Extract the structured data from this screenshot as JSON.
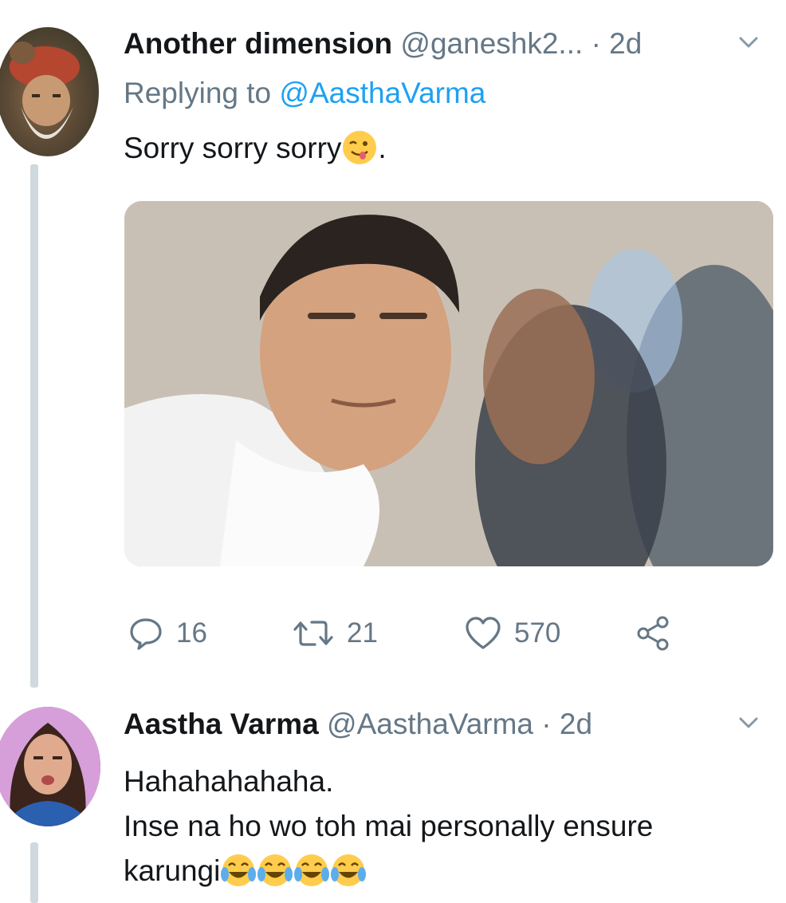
{
  "tweets": [
    {
      "name": "Another dimension",
      "handle": "@ganeshk2...",
      "dot": "·",
      "time": "2d",
      "replying_prefix": "Replying to",
      "replying_handle": "@AasthaVarma",
      "text": "Sorry sorry sorry",
      "text_suffix": ".",
      "emoji": "winking-face-with-tongue",
      "image_alt": "photo-of-man-in-white-kurta",
      "reply_count": "16",
      "retweet_count": "21",
      "like_count": "570"
    },
    {
      "name": "Aastha Varma",
      "handle": "@AasthaVarma",
      "dot": "·",
      "time": "2d",
      "text_line1": "Hahahahahaha.",
      "text_line2": "Inse na ho wo toh mai personally ensure",
      "text_line3": "karungi",
      "emoji": "face-with-tears-of-joy",
      "emoji_count": 4
    }
  ],
  "colors": {
    "link": "#1da1f2",
    "secondary_text": "#657786",
    "thread_line": "#cfd9de"
  }
}
